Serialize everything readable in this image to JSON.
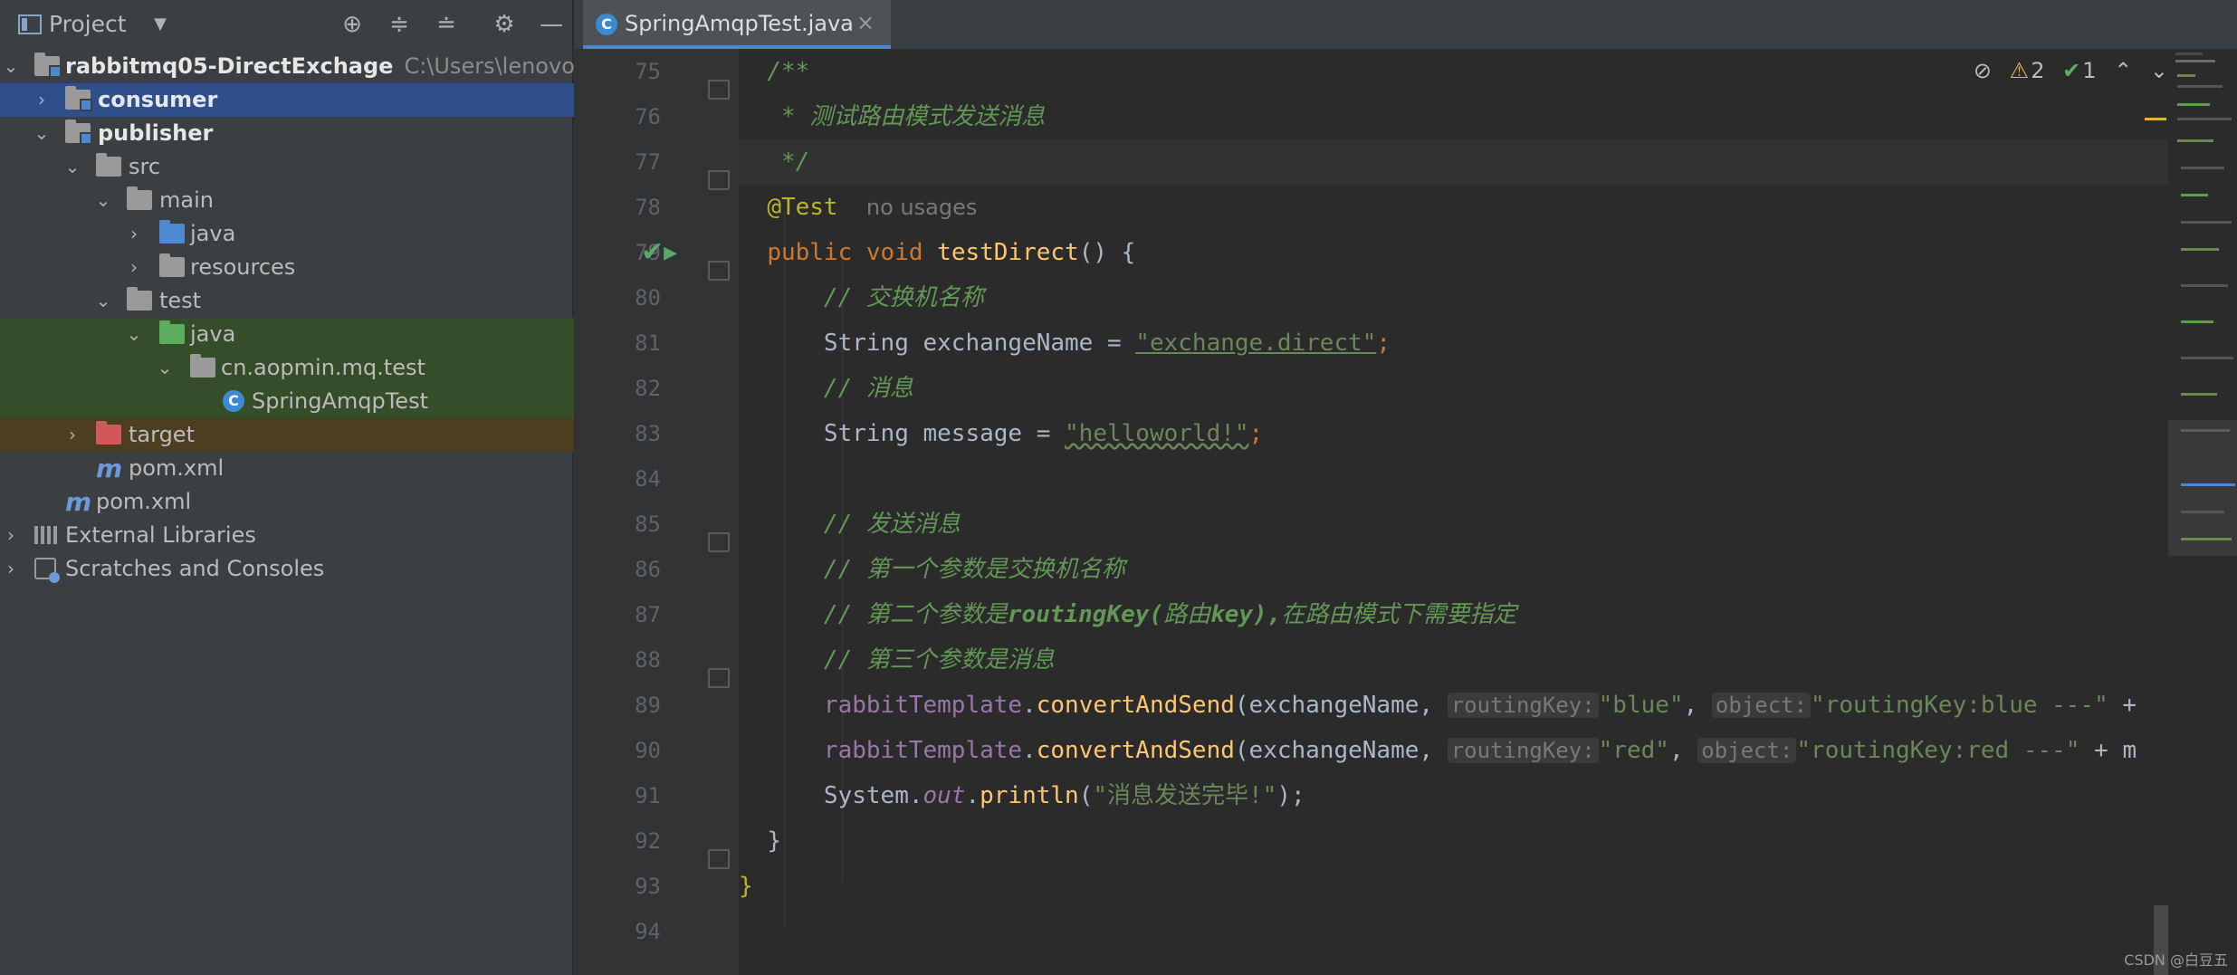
{
  "project_panel": {
    "title": "Project",
    "tree": [
      {
        "label": "rabbitmq05-DirectExchage",
        "path": "C:\\Users\\lenovo\\De",
        "icon": "module-folder-icon",
        "expanded": true
      },
      {
        "label": "consumer",
        "icon": "module-folder-icon",
        "expanded": false,
        "selected": true
      },
      {
        "label": "publisher",
        "icon": "module-folder-icon",
        "expanded": true
      },
      {
        "label": "src",
        "icon": "folder-icon",
        "expanded": true
      },
      {
        "label": "main",
        "icon": "folder-icon",
        "expanded": true
      },
      {
        "label": "java",
        "icon": "source-folder-icon",
        "expanded": false
      },
      {
        "label": "resources",
        "icon": "resources-folder-icon",
        "expanded": false
      },
      {
        "label": "test",
        "icon": "folder-icon",
        "expanded": true
      },
      {
        "label": "java",
        "icon": "test-source-folder-icon",
        "expanded": true
      },
      {
        "label": "cn.aopmin.mq.test",
        "icon": "package-icon",
        "expanded": true
      },
      {
        "label": "SpringAmqpTest",
        "icon": "class-icon"
      },
      {
        "label": "target",
        "icon": "excluded-folder-icon",
        "expanded": false
      },
      {
        "label": "pom.xml",
        "icon": "maven-icon"
      },
      {
        "label": "pom.xml",
        "icon": "maven-icon"
      },
      {
        "label": "External Libraries",
        "icon": "library-icon",
        "expanded": false
      },
      {
        "label": "Scratches and Consoles",
        "icon": "scratches-icon",
        "expanded": false
      }
    ]
  },
  "editor": {
    "tab_label": "SpringAmqpTest.java",
    "inspection": {
      "warnings": "2",
      "weak_warnings": "1"
    },
    "line_numbers": [
      "75",
      "76",
      "77",
      "78",
      "79",
      "80",
      "81",
      "82",
      "83",
      "84",
      "85",
      "86",
      "87",
      "88",
      "89",
      "90",
      "91",
      "92",
      "93",
      "94"
    ],
    "code": {
      "l75": "/**",
      "l76": " * 测试路由模式发送消息",
      "l77": " */",
      "l78_annotation": "@Test",
      "l78_usages": "no usages",
      "l79_kw1": "public",
      "l79_kw2": "void",
      "l79_method": "testDirect",
      "l79_rest": "() {",
      "l80": "// 交换机名称",
      "l81_type": "String",
      "l81_var": " exchangeName = ",
      "l81_str": "\"exchange.direct\"",
      "l81_end": ";",
      "l82": "// 消息",
      "l83_type": "String",
      "l83_var": " message = ",
      "l83_str": "\"helloworld!\"",
      "l83_end": ";",
      "l85": "// 发送消息",
      "l86": "// 第一个参数是交换机名称",
      "l87_a": "// 第二个参数是",
      "l87_b": "routingKey(",
      "l87_c": "路由",
      "l87_d": "key),",
      "l87_e": "在路由模式下需要指定",
      "l88": "// 第三个参数是消息",
      "l89_obj": "rabbitTemplate",
      "l89_method": "convertAndSend",
      "l89_arg1": "(exchangeName,",
      "l89_hint1": "routingKey:",
      "l89_str1": "\"blue\"",
      "l89_hint2": "object:",
      "l89_str2": "\"routingKey:blue ---\"",
      "l89_tail": " +",
      "l90_obj": "rabbitTemplate",
      "l90_method": "convertAndSend",
      "l90_arg1": "(exchangeName,",
      "l90_hint1": "routingKey:",
      "l90_str1": "\"red\"",
      "l90_hint2": "object:",
      "l90_str2": "\"routingKey:red ---\"",
      "l90_tail": " + m",
      "l91_cls": "System",
      "l91_fld": "out",
      "l91_method": "println",
      "l91_str": "\"消息发送完毕!\"",
      "l91_end": ");",
      "l92": "}",
      "l93": "}"
    }
  },
  "watermark": "CSDN @白豆五",
  "colors": {
    "keyword": "#cc7832",
    "comment": "#629755",
    "string": "#6a8759",
    "method": "#ffc66d",
    "field": "#9876aa",
    "annotation": "#bbb529",
    "selection": "#2f4f8a"
  }
}
